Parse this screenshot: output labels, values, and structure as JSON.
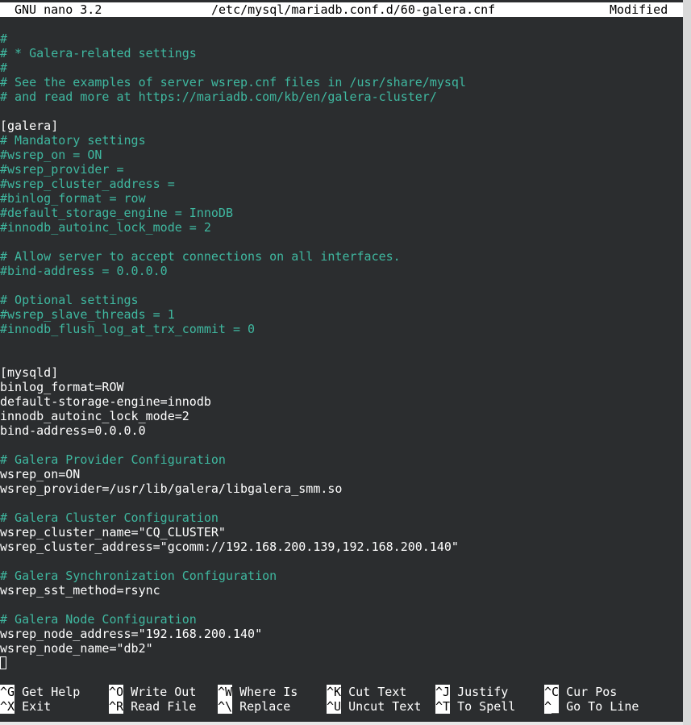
{
  "titlebar": {
    "app": "GNU nano 3.2",
    "file": "/etc/mysql/mariadb.conf.d/60-galera.cnf",
    "status": "Modified"
  },
  "lines": [
    {
      "type": "cm",
      "text": "#"
    },
    {
      "type": "cm",
      "text": "# * Galera-related settings"
    },
    {
      "type": "cm",
      "text": "#"
    },
    {
      "type": "cm",
      "text": "# See the examples of server wsrep.cnf files in /usr/share/mysql"
    },
    {
      "type": "cm",
      "text": "# and read more at https://mariadb.com/kb/en/galera-cluster/"
    },
    {
      "type": "tx",
      "text": ""
    },
    {
      "type": "tx",
      "text": "[galera]"
    },
    {
      "type": "cm",
      "text": "# Mandatory settings"
    },
    {
      "type": "cm",
      "text": "#wsrep_on = ON"
    },
    {
      "type": "cm",
      "text": "#wsrep_provider ="
    },
    {
      "type": "cm",
      "text": "#wsrep_cluster_address ="
    },
    {
      "type": "cm",
      "text": "#binlog_format = row"
    },
    {
      "type": "cm",
      "text": "#default_storage_engine = InnoDB"
    },
    {
      "type": "cm",
      "text": "#innodb_autoinc_lock_mode = 2"
    },
    {
      "type": "tx",
      "text": ""
    },
    {
      "type": "cm",
      "text": "# Allow server to accept connections on all interfaces."
    },
    {
      "type": "cm",
      "text": "#bind-address = 0.0.0.0"
    },
    {
      "type": "tx",
      "text": ""
    },
    {
      "type": "cm",
      "text": "# Optional settings"
    },
    {
      "type": "cm",
      "text": "#wsrep_slave_threads = 1"
    },
    {
      "type": "cm",
      "text": "#innodb_flush_log_at_trx_commit = 0"
    },
    {
      "type": "tx",
      "text": ""
    },
    {
      "type": "tx",
      "text": ""
    },
    {
      "type": "tx",
      "text": "[mysqld]"
    },
    {
      "type": "tx",
      "text": "binlog_format=ROW"
    },
    {
      "type": "tx",
      "text": "default-storage-engine=innodb"
    },
    {
      "type": "tx",
      "text": "innodb_autoinc_lock_mode=2"
    },
    {
      "type": "tx",
      "text": "bind-address=0.0.0.0"
    },
    {
      "type": "tx",
      "text": ""
    },
    {
      "type": "cm",
      "text": "# Galera Provider Configuration"
    },
    {
      "type": "tx",
      "text": "wsrep_on=ON"
    },
    {
      "type": "tx",
      "text": "wsrep_provider=/usr/lib/galera/libgalera_smm.so"
    },
    {
      "type": "tx",
      "text": ""
    },
    {
      "type": "cm",
      "text": "# Galera Cluster Configuration"
    },
    {
      "type": "tx",
      "text": "wsrep_cluster_name=\"CQ_CLUSTER\""
    },
    {
      "type": "tx",
      "text": "wsrep_cluster_address=\"gcomm://192.168.200.139,192.168.200.140\""
    },
    {
      "type": "tx",
      "text": ""
    },
    {
      "type": "cm",
      "text": "# Galera Synchronization Configuration"
    },
    {
      "type": "tx",
      "text": "wsrep_sst_method=rsync"
    },
    {
      "type": "tx",
      "text": ""
    },
    {
      "type": "cm",
      "text": "# Galera Node Configuration"
    },
    {
      "type": "tx",
      "text": "wsrep_node_address=\"192.168.200.140\""
    },
    {
      "type": "tx",
      "text": "wsrep_node_name=\"db2\""
    }
  ],
  "shortcuts": [
    {
      "key": "^G",
      "label": "Get Help"
    },
    {
      "key": "^X",
      "label": "Exit"
    },
    {
      "key": "^O",
      "label": "Write Out"
    },
    {
      "key": "^R",
      "label": "Read File"
    },
    {
      "key": "^W",
      "label": "Where Is"
    },
    {
      "key": "^\\",
      "label": "Replace"
    },
    {
      "key": "^K",
      "label": "Cut Text"
    },
    {
      "key": "^U",
      "label": "Uncut Text"
    },
    {
      "key": "^J",
      "label": "Justify"
    },
    {
      "key": "^T",
      "label": "To Spell"
    },
    {
      "key": "^C",
      "label": "Cur Pos"
    },
    {
      "key": "^_",
      "label": "Go To Line"
    }
  ],
  "colors": {
    "background": "#2b2d2f",
    "comment": "#3fb8a0",
    "text": "#ffffff",
    "titlebar_bg": "#ffffff"
  }
}
